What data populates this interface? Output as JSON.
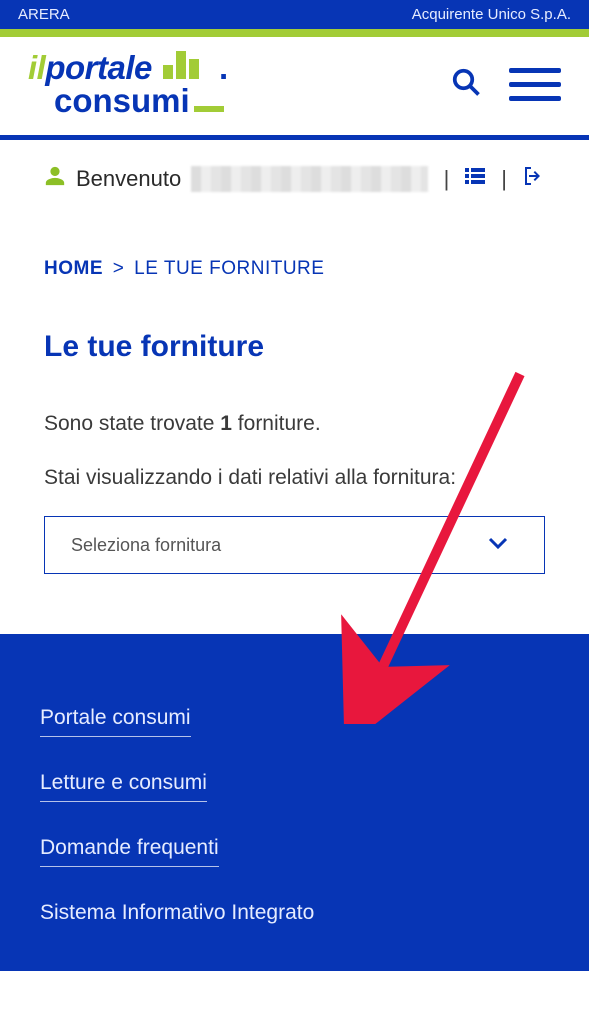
{
  "topbar": {
    "left": "ARERA",
    "right": "Acquirente Unico S.p.A."
  },
  "logo": {
    "line1a": "il",
    "line1b": "portale",
    "line2": "consumi"
  },
  "welcome": {
    "label": "Benvenuto",
    "sep": "|"
  },
  "breadcrumb": {
    "home": "HOME",
    "sep": ">",
    "current": "LE TUE FORNITURE"
  },
  "page": {
    "title": "Le tue forniture",
    "intro_pre": "Sono state trovate ",
    "intro_count": "1",
    "intro_post": " forniture.",
    "sub": "Stai visualizzando i dati relativi alla fornitura:"
  },
  "select": {
    "placeholder": "Seleziona fornitura"
  },
  "footer": {
    "links": [
      "Portale consumi",
      "Letture e consumi",
      "Domande frequenti",
      "Sistema Informativo Integrato"
    ]
  }
}
